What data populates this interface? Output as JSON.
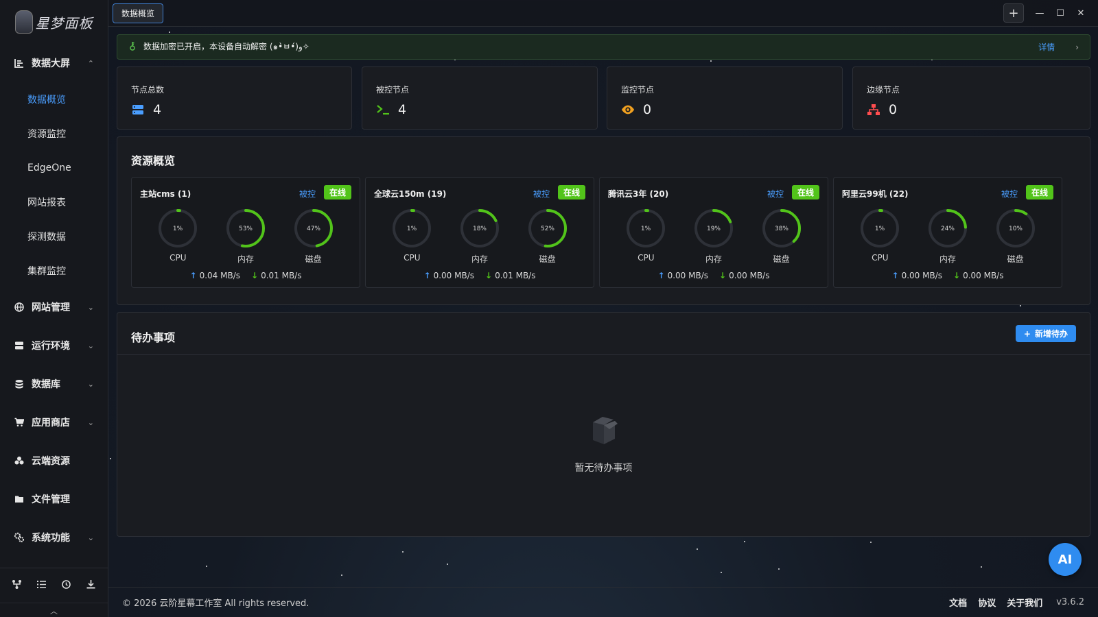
{
  "app": {
    "logo_text": "星梦面板"
  },
  "sidebar": {
    "group_dashboard": "数据大屏",
    "subitems": [
      "数据概览",
      "资源监控",
      "EdgeOne",
      "网站报表",
      "探测数据",
      "集群监控"
    ],
    "groups": [
      {
        "label": "网站管理",
        "icon": "globe-icon",
        "chevron": "⌄"
      },
      {
        "label": "运行环境",
        "icon": "server-icon",
        "chevron": "⌄"
      },
      {
        "label": "数据库",
        "icon": "database-icon",
        "chevron": "⌄"
      },
      {
        "label": "应用商店",
        "icon": "cart-icon",
        "chevron": "⌄"
      },
      {
        "label": "云端资源",
        "icon": "cloud-icon",
        "chevron": ""
      },
      {
        "label": "文件管理",
        "icon": "folder-icon",
        "chevron": ""
      },
      {
        "label": "系统功能",
        "icon": "gears-icon",
        "chevron": "⌄"
      }
    ]
  },
  "topbar": {
    "tab_label": "数据概览"
  },
  "banner": {
    "text": "数据加密已开启，本设备自动解密 (๑•̀ㅂ•́)و✧",
    "detail": "详情"
  },
  "stats": [
    {
      "label": "节点总数",
      "value": "4",
      "icon": "server-stack-icon",
      "color": "#4a9eff"
    },
    {
      "label": "被控节点",
      "value": "4",
      "icon": "terminal-icon",
      "color": "#52c41a"
    },
    {
      "label": "监控节点",
      "value": "0",
      "icon": "eye-icon",
      "color": "#f0a020"
    },
    {
      "label": "边缘节点",
      "value": "0",
      "icon": "network-icon",
      "color": "#ff4d4f"
    }
  ],
  "resources": {
    "title": "资源概览",
    "controlled_label": "被控",
    "online_label": "在线",
    "metric_labels": [
      "CPU",
      "内存",
      "磁盘"
    ],
    "servers": [
      {
        "name": "主站cms (1)",
        "cpu": 1,
        "mem": 53,
        "disk": 47,
        "up": "0.04 MB/s",
        "down": "0.01 MB/s"
      },
      {
        "name": "全球云150m (19)",
        "cpu": 1,
        "mem": 18,
        "disk": 52,
        "up": "0.00 MB/s",
        "down": "0.01 MB/s"
      },
      {
        "name": "腾讯云3年 (20)",
        "cpu": 1,
        "mem": 19,
        "disk": 38,
        "up": "0.00 MB/s",
        "down": "0.00 MB/s"
      },
      {
        "name": "阿里云99机 (22)",
        "cpu": 1,
        "mem": 24,
        "disk": 10,
        "up": "0.00 MB/s",
        "down": "0.00 MB/s"
      }
    ]
  },
  "todo": {
    "title": "待办事项",
    "add_label": "新增待办",
    "empty_text": "暂无待办事项"
  },
  "footer": {
    "copyright": "© 2026 云阶星幕工作室 All rights reserved.",
    "links": [
      "文档",
      "协议",
      "关于我们"
    ],
    "version": "v3.6.2"
  },
  "ai_button": "AI",
  "colors": {
    "accent": "#4a9eff",
    "online": "#52c41a",
    "gauge_track": "#2e3138"
  }
}
